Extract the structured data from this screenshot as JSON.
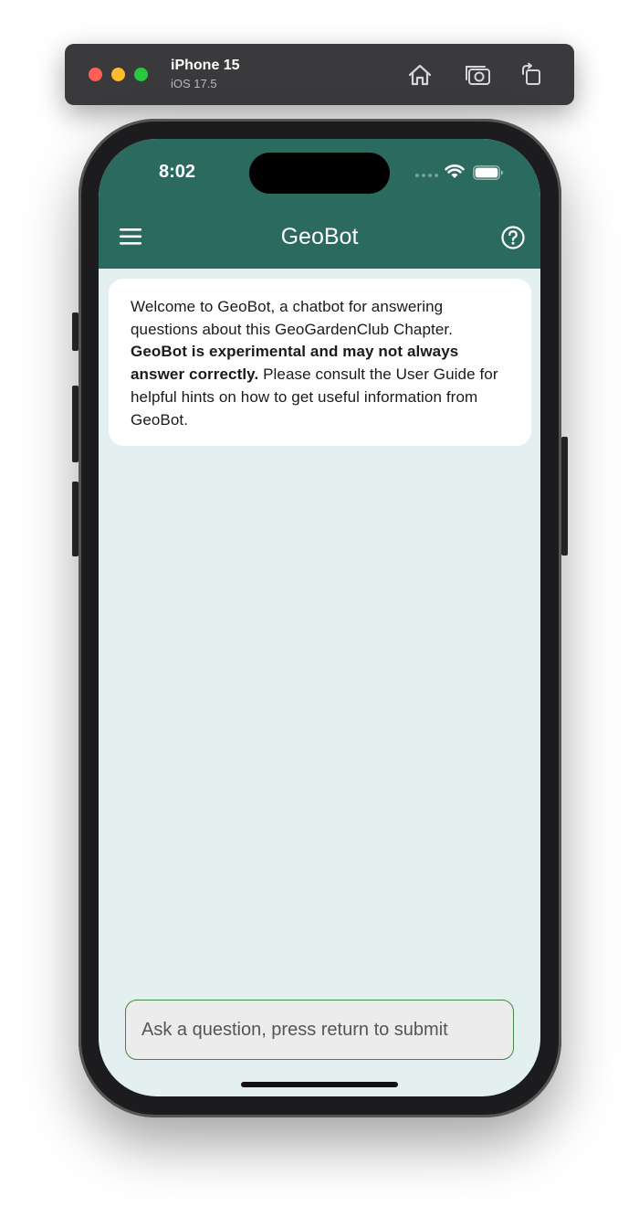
{
  "simulator": {
    "device_name": "iPhone 15",
    "os_version": "iOS 17.5"
  },
  "status_bar": {
    "time": "8:02"
  },
  "header": {
    "title": "GeoBot"
  },
  "welcome": {
    "intro": "Welcome to GeoBot, a chatbot for answering questions about this GeoGardenClub Chapter. ",
    "warning": "GeoBot is experimental and may not always answer correctly.",
    "outro": " Please consult the User Guide for helpful hints on how to get useful information from GeoBot."
  },
  "input": {
    "placeholder": "Ask a question, press return to submit",
    "value": ""
  },
  "colors": {
    "header": "#2b6a5e",
    "background": "#e3f0ef",
    "input_border": "#3f8a3f"
  }
}
